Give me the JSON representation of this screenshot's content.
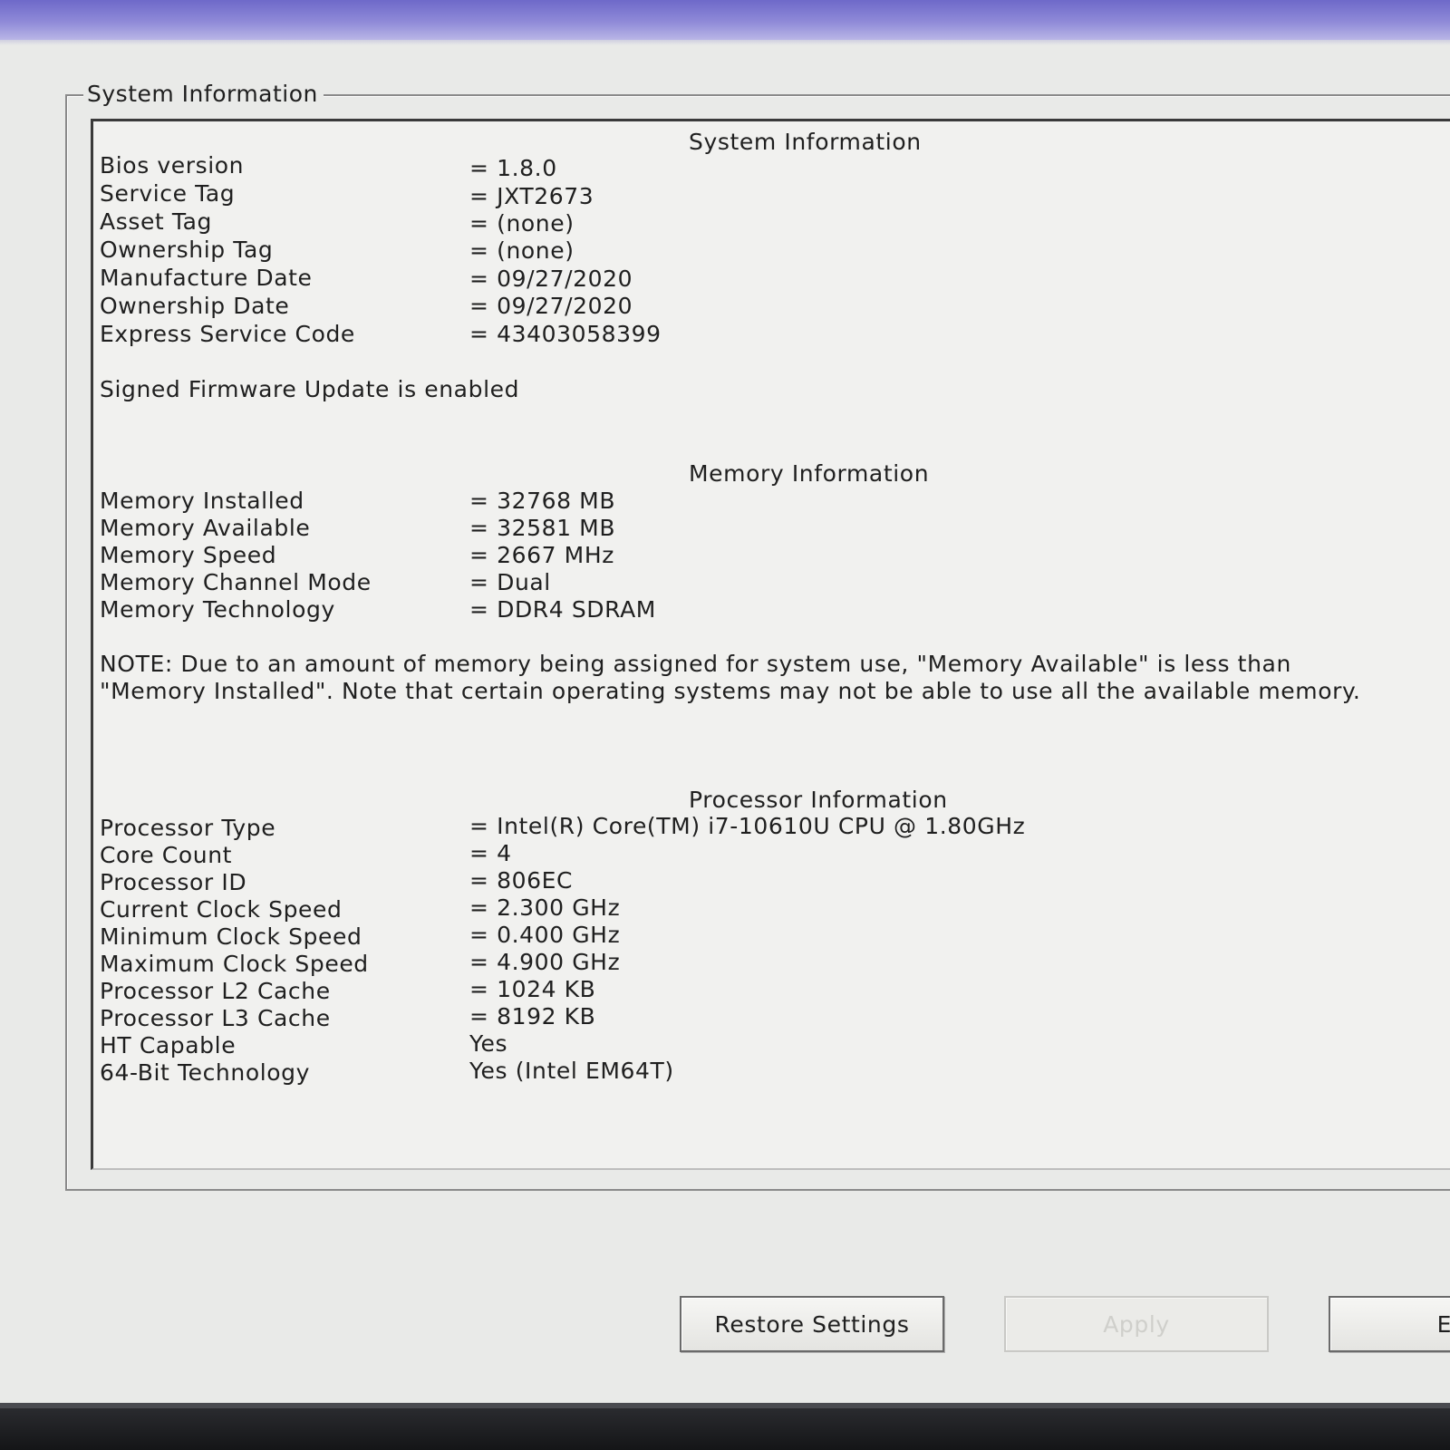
{
  "groupbox": {
    "legend": "System Information"
  },
  "system": {
    "title": "System Information",
    "rows": [
      {
        "label": "Bios version",
        "value": "= 1.8.0"
      },
      {
        "label": "Service Tag",
        "value": "= JXT2673"
      },
      {
        "label": "Asset Tag",
        "value": "= (none)"
      },
      {
        "label": "Ownership Tag",
        "value": "= (none)"
      },
      {
        "label": "Manufacture Date",
        "value": "= 09/27/2020"
      },
      {
        "label": "Ownership Date",
        "value": "= 09/27/2020"
      },
      {
        "label": "Express Service Code",
        "value": "= 43403058399"
      }
    ],
    "firmware_status": "Signed Firmware Update is enabled"
  },
  "memory": {
    "title": "Memory Information",
    "rows": [
      {
        "label": "Memory Installed",
        "value": "= 32768 MB"
      },
      {
        "label": "Memory Available",
        "value": "= 32581 MB"
      },
      {
        "label": "Memory Speed",
        "value": "= 2667 MHz"
      },
      {
        "label": "Memory Channel Mode",
        "value": "= Dual"
      },
      {
        "label": "Memory Technology",
        "value": "= DDR4 SDRAM"
      }
    ],
    "note": "NOTE: Due to an amount of memory being assigned for system use, \"Memory Available\" is less than \"Memory Installed\". Note that certain operating systems may not be able to use all the available memory."
  },
  "processor": {
    "title": "Processor Information",
    "rows": [
      {
        "label": "Processor Type",
        "value": "= Intel(R) Core(TM) i7-10610U CPU @ 1.80GHz"
      },
      {
        "label": "Core Count",
        "value": "= 4"
      },
      {
        "label": "Processor ID",
        "value": "= 806EC"
      },
      {
        "label": "Current Clock Speed",
        "value": "= 2.300 GHz"
      },
      {
        "label": "Minimum Clock Speed",
        "value": "= 0.400 GHz"
      },
      {
        "label": "Maximum Clock Speed",
        "value": "= 4.900 GHz"
      },
      {
        "label": "Processor L2 Cache",
        "value": "= 1024 KB"
      },
      {
        "label": "Processor L3 Cache",
        "value": "= 8192 KB"
      },
      {
        "label": "HT Capable",
        "value": "Yes"
      },
      {
        "label": "64-Bit Technology",
        "value": "Yes (Intel EM64T)"
      }
    ]
  },
  "buttons": {
    "restore": "Restore Settings",
    "apply": "Apply",
    "third": "E"
  }
}
